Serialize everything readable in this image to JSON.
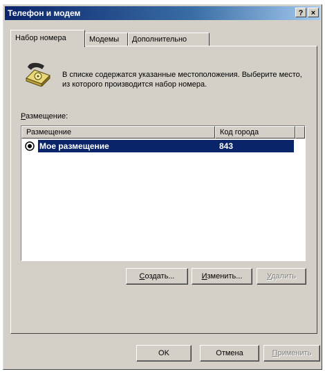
{
  "window": {
    "title": "Телефон и модем",
    "help_button": "?",
    "close_button": "×"
  },
  "tabs": [
    {
      "label": "Набор номера",
      "active": true
    },
    {
      "label": "Модемы",
      "active": false
    },
    {
      "label": "Дополнительно",
      "active": false
    }
  ],
  "dialing": {
    "intro_text": "В списке содержатся указанные местоположения. Выберите место, из которого производится набор номера.",
    "list_label_prefix": "Р",
    "list_label_rest": "азмещение:",
    "columns": [
      "Размещение",
      "Код города"
    ],
    "rows": [
      {
        "name": "Мое размещение",
        "area_code": "843",
        "selected": true
      }
    ],
    "buttons": {
      "create_prefix": "С",
      "create_rest": "оздать...",
      "edit_prefix": "И",
      "edit_rest": "зменить...",
      "delete_prefix": "У",
      "delete_rest": "далить"
    }
  },
  "footer": {
    "ok": "OK",
    "cancel": "Отмена",
    "apply_prefix": "П",
    "apply_rest": "рименить"
  },
  "colors": {
    "title_gradient_start": "#0a246a",
    "selection": "#0a246a",
    "face": "#d4d0c8"
  }
}
